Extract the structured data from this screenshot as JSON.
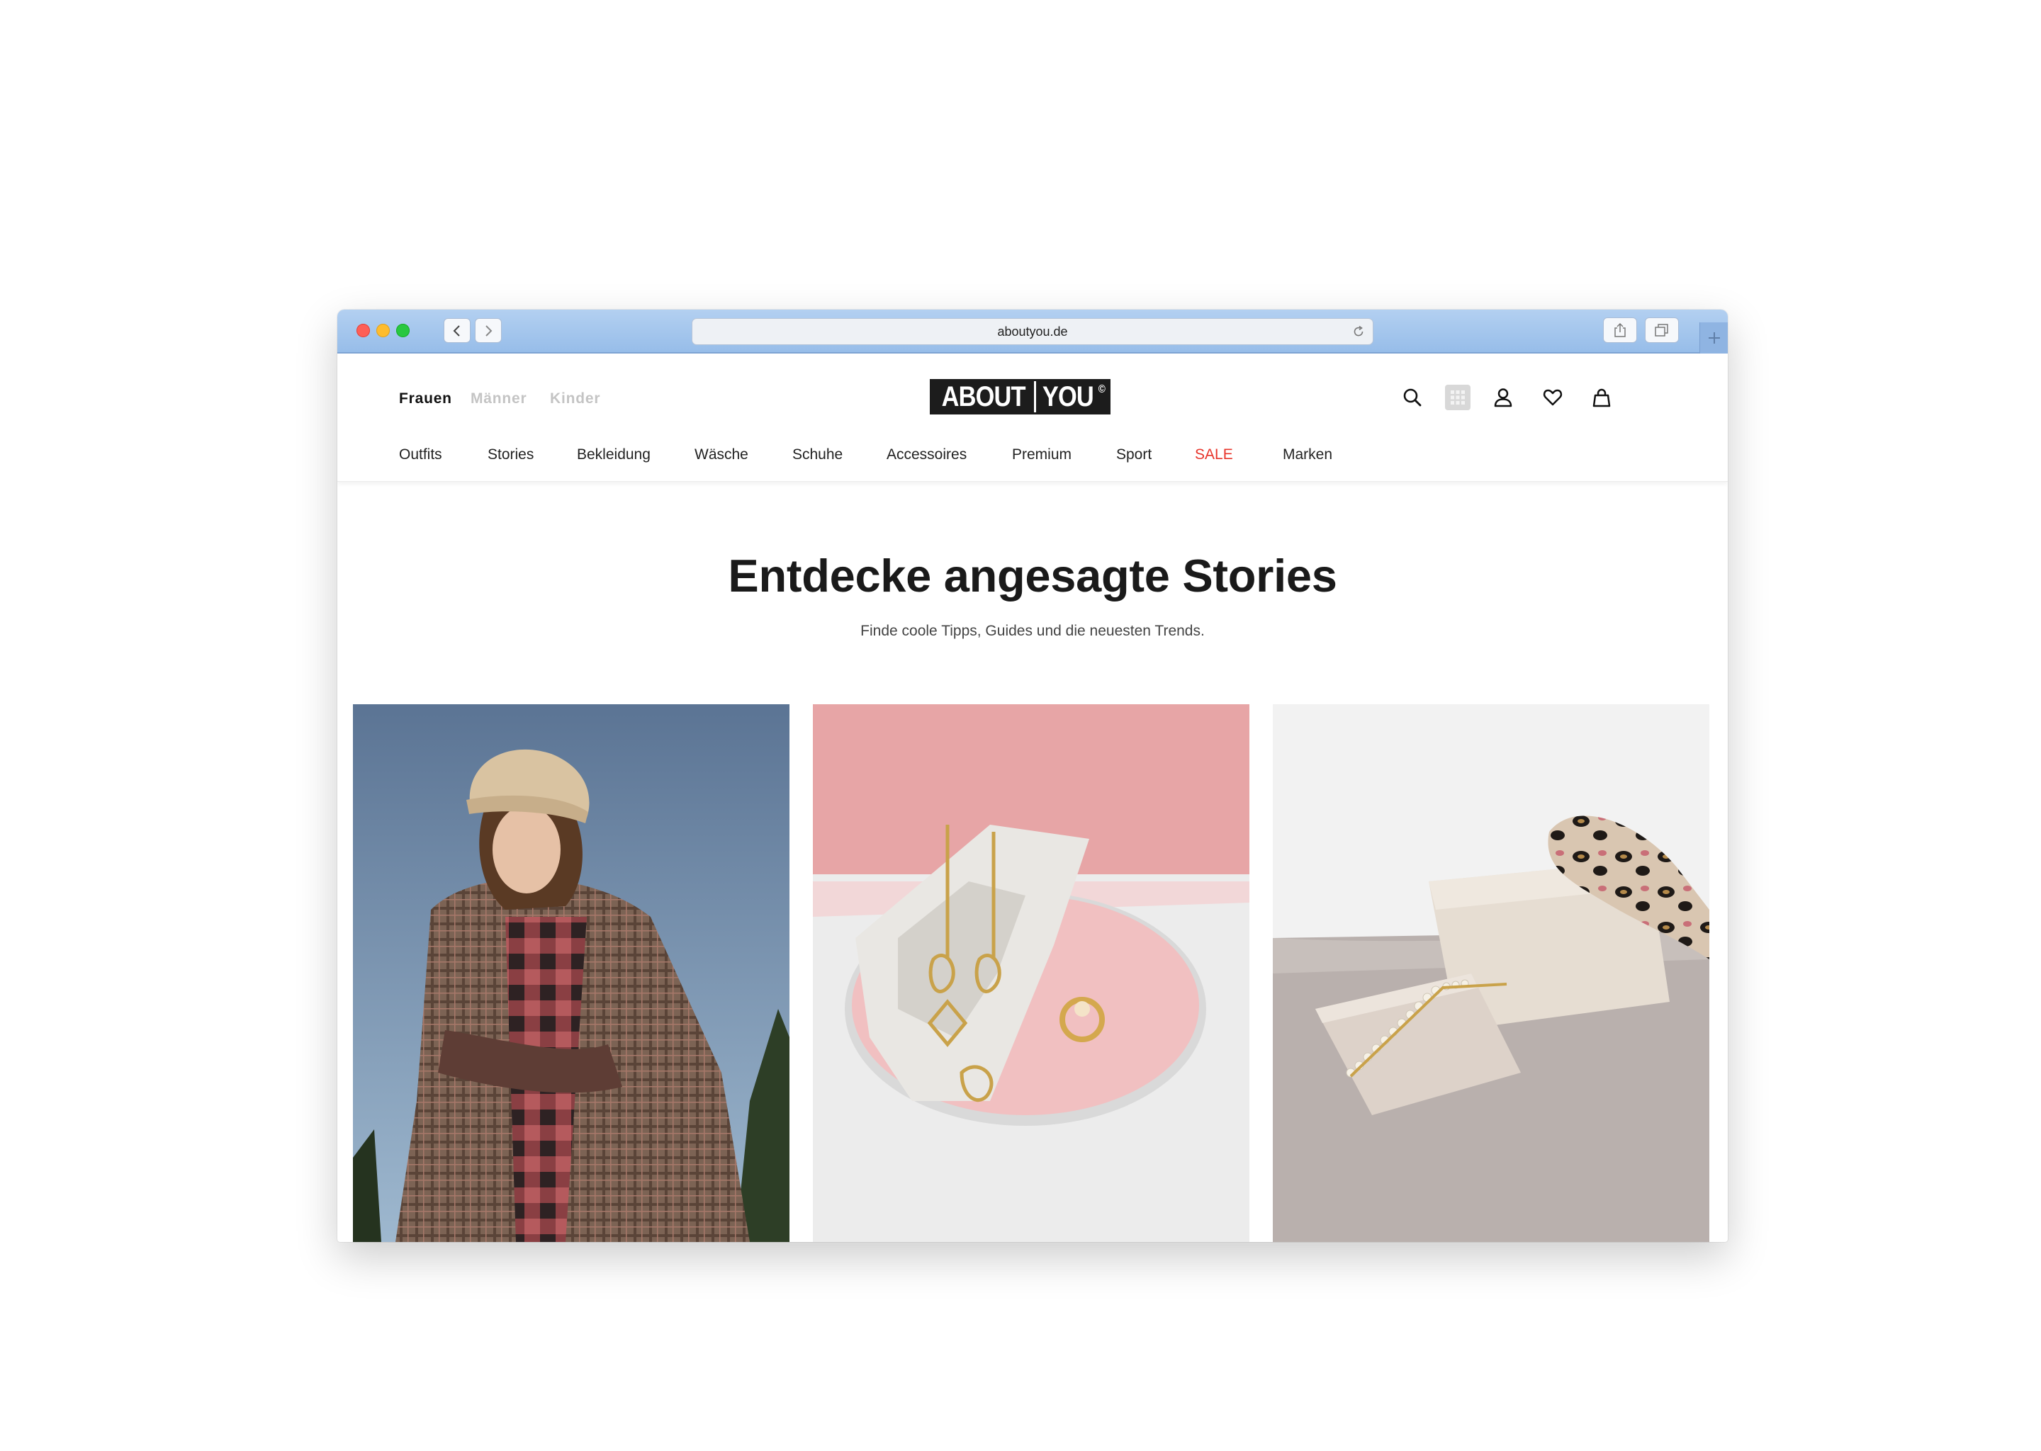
{
  "browser": {
    "url": "aboutyou.de"
  },
  "header": {
    "genders": [
      "Frauen",
      "Männer",
      "Kinder"
    ],
    "active_gender": "Frauen",
    "logo_left": "ABOUT",
    "logo_right": "YOU",
    "logo_mark": "©",
    "icons": [
      "search-icon",
      "apps-grid-icon",
      "account-icon",
      "wishlist-heart-icon",
      "shopping-bag-icon"
    ],
    "categories": [
      "Outfits",
      "Stories",
      "Bekleidung",
      "Wäsche",
      "Schuhe",
      "Accessoires",
      "Premium",
      "Sport",
      "SALE",
      "Marken"
    ],
    "sale_color": "#e8352b"
  },
  "hero": {
    "title": "Entdecke angesagte Stories",
    "subtitle": "Finde coole Tipps, Guides und die neuesten Trends."
  },
  "story_cards": [
    {
      "image": "woman in beanie and plaid coat"
    },
    {
      "image": "gold earrings and rings on stone and mirror"
    },
    {
      "image": "pearl hair clip on stone with leopard scarf"
    }
  ]
}
